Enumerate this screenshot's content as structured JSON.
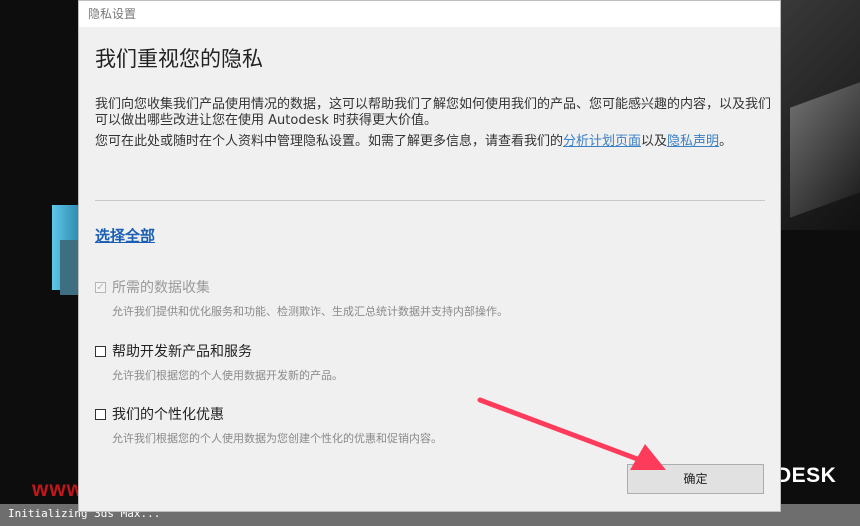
{
  "background": {
    "brand_text": "DESK",
    "watermark": "www.dgrai.com",
    "status_text": "Initializing 3ds Max..."
  },
  "dialog": {
    "title": "隐私设置",
    "heading": "我们重视您的隐私",
    "para1": "我们向您收集我们产品使用情况的数据，这可以帮助我们了解您如何使用我们的产品、您可能感兴趣的内容，以及我们可以做出哪些改进让您在使用 Autodesk 时获得更大价值。",
    "para2_prefix": "您可在此处或随时在个人资料中管理隐私设置。如需了解更多信息，请查看我们的",
    "link_analytics": "分析计划页面",
    "para2_middle": "以及",
    "link_privacy": "隐私声明",
    "para2_suffix": "。",
    "select_all": "选择全部",
    "options": [
      {
        "label": "所需的数据收集",
        "desc": "允许我们提供和优化服务和功能、检测欺诈、生成汇总统计数据并支持内部操作。",
        "checked": true,
        "disabled": true
      },
      {
        "label": "帮助开发新产品和服务",
        "desc": "允许我们根据您的个人使用数据开发新的产品。",
        "checked": false,
        "disabled": false
      },
      {
        "label": "我们的个性化优惠",
        "desc": "允许我们根据您的个人使用数据为您创建个性化的优惠和促销内容。",
        "checked": false,
        "disabled": false
      }
    ],
    "ok_label": "确定"
  },
  "colors": {
    "link": "#3b7fc4",
    "annotation_arrow": "#ff3b5c"
  }
}
